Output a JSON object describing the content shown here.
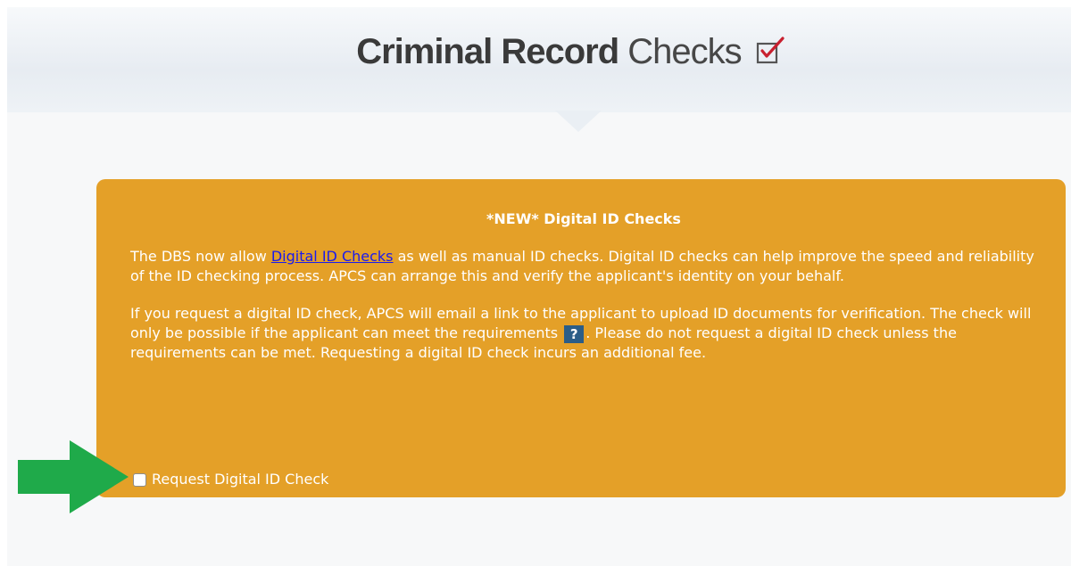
{
  "header": {
    "title_bold": "Criminal Record",
    "title_light": "Checks",
    "icon": "checkbox-tick-icon",
    "accent_color": "#c8202f"
  },
  "notice": {
    "background_color": "#e4a028",
    "heading": "*NEW* Digital ID Checks",
    "para1_before_link": "The DBS now allow ",
    "para1_link": "Digital ID Checks",
    "para1_after_link": " as well as manual ID checks. Digital ID checks can help improve the speed and reliability of the ID checking process. APCS can arrange this and verify the applicant's identity on your behalf.",
    "para2_before_help": "If you request a digital ID check, APCS will email a link to the applicant to upload ID documents for verification. The check will only be possible if the applicant can meet the requirements ",
    "help_label": "?",
    "para2_after_help": ". Please do not request a digital ID check unless the requirements can be met. Requesting a digital ID check incurs an additional fee.",
    "checkbox_label": "Request Digital ID Check",
    "checkbox_checked": false
  },
  "annotation": {
    "icon": "arrow-right-icon",
    "color": "#1faa4a"
  }
}
